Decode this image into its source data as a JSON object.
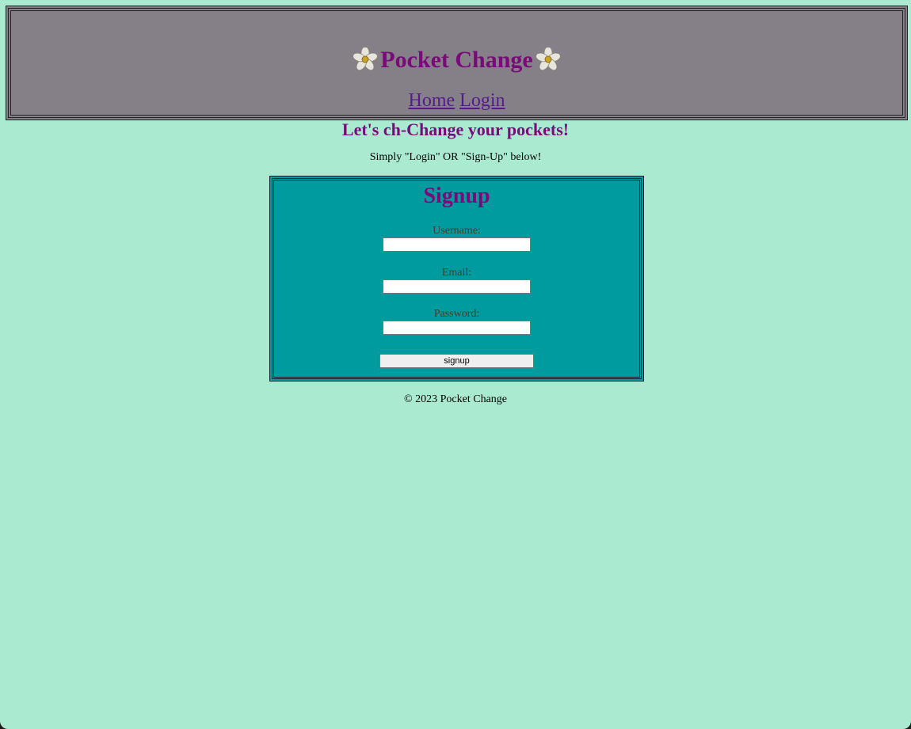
{
  "header": {
    "title": "Pocket Change",
    "icon": "flower-icon",
    "nav": [
      {
        "label": "Home"
      },
      {
        "label": "Login"
      }
    ]
  },
  "tagline": "Let's ch-Change your pockets!",
  "subtext": "Simply \"Login\" OR \"Sign-Up\" below!",
  "signup": {
    "title": "Signup",
    "fields": [
      {
        "label": "Username:",
        "value": ""
      },
      {
        "label": "Email:",
        "value": ""
      },
      {
        "label": "Password:",
        "value": ""
      }
    ],
    "submit_label": "signup"
  },
  "footer": "© 2023 Pocket Change",
  "colors": {
    "page_background": "#a9ead1",
    "header_background": "#857f88",
    "form_background": "#009b9f",
    "heading": "#7a0a7a",
    "link": "#551a8b"
  }
}
